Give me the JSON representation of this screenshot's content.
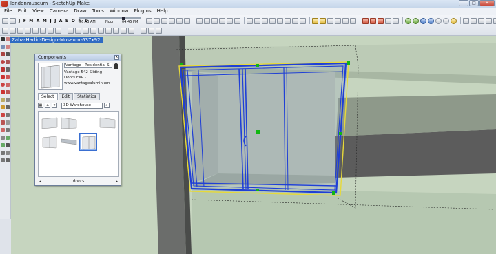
{
  "window": {
    "title": "londonmuseum - SketchUp Make",
    "buttons": [
      "–",
      "□",
      "✕"
    ]
  },
  "menu": [
    "File",
    "Edit",
    "View",
    "Camera",
    "Draw",
    "Tools",
    "Window",
    "Plugins",
    "Help"
  ],
  "toolbar": {
    "months": "J F M A M J J A S O N D",
    "time_start": "06:43 AM",
    "time_noon": "Noon",
    "time_end": "04:45 PM"
  },
  "scene": {
    "tab_label": "Zaha-Hadid-Design-Museum-637x92"
  },
  "components": {
    "title": "Components",
    "close": "x",
    "name": "Vantage - Residential Sl",
    "description": "Vantage 542 Sliding\nDoors FXP -\nwww.vantagealuminium",
    "tabs": [
      "Select",
      "Edit",
      "Statistics"
    ],
    "search_placeholder": "3D Warehouse",
    "status": "doors"
  },
  "colors": {
    "selection": "#1f3fd6",
    "ground": "#c3d3bc",
    "wall_dark": "#6b6b6b",
    "title_bar": "#c9d9ec"
  }
}
